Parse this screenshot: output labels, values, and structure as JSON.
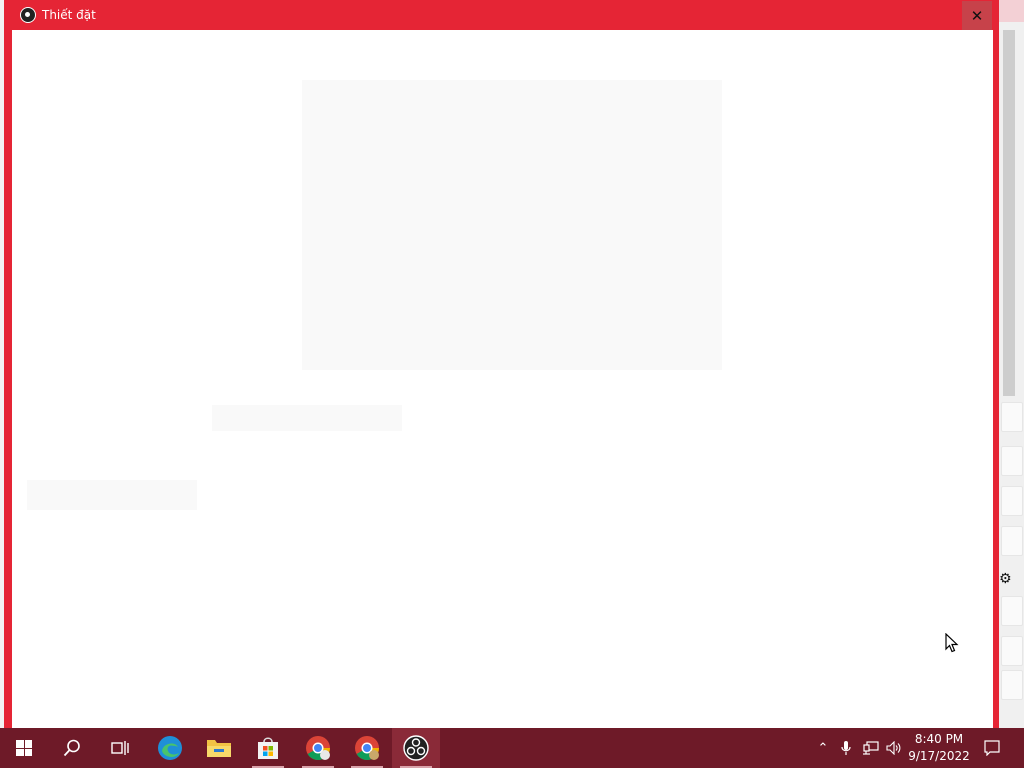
{
  "window": {
    "title": "Thiết đặt",
    "close_glyph": "✕",
    "accent": "#e52535",
    "close_bg": "#c7424a"
  },
  "taskbar": {
    "items": [
      {
        "icon": "windows-start-icon"
      },
      {
        "icon": "search-icon"
      },
      {
        "icon": "task-view-icon"
      },
      {
        "icon": "edge-icon"
      },
      {
        "icon": "file-explorer-icon"
      },
      {
        "icon": "microsoft-store-icon"
      },
      {
        "icon": "chrome-icon"
      },
      {
        "icon": "chrome-icon"
      },
      {
        "icon": "obs-icon"
      }
    ],
    "tray": {
      "chevron": "⌃",
      "time": "8:40 PM",
      "date": "9/17/2022"
    },
    "color": "#6e1a28"
  }
}
